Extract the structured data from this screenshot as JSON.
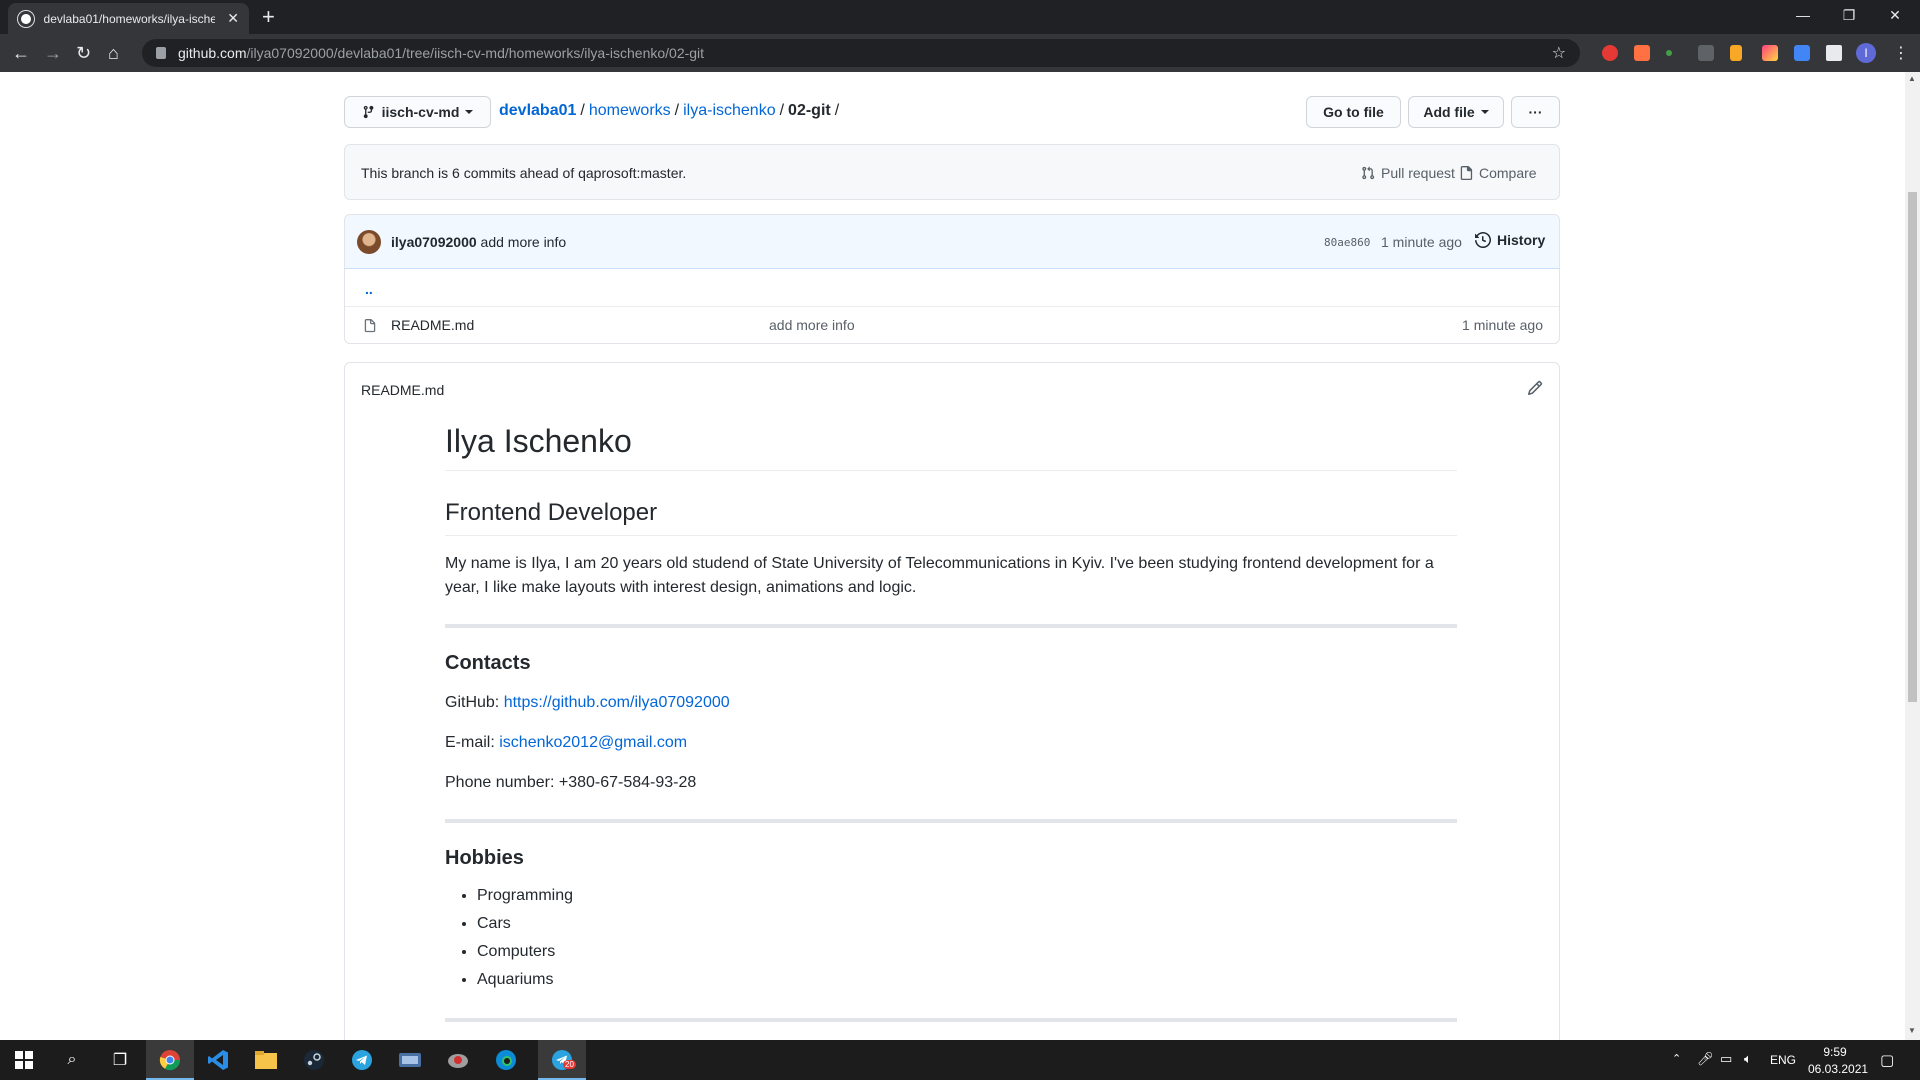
{
  "browser": {
    "tab_title": "devlaba01/homeworks/ilya-ische",
    "url_host": "github.com",
    "url_path": "/ilya07092000/devlaba01/tree/iisch-cv-md/homeworks/ilya-ischenko/02-git",
    "profile_initial": "I"
  },
  "repo": {
    "branch": "iisch-cv-md",
    "breadcrumb": {
      "root": "devlaba01",
      "parts": [
        "homeworks",
        "ilya-ischenko"
      ],
      "current": "02-git"
    },
    "go_to_file": "Go to file",
    "add_file": "Add file",
    "more": "···",
    "ahead_message": "This branch is 6 commits ahead of qaprosoft:master.",
    "pull_request": "Pull request",
    "compare": "Compare"
  },
  "commit": {
    "author": "ilya07092000",
    "message": "add more info",
    "sha": "80ae860",
    "time": "1 minute ago",
    "history": "History"
  },
  "files": {
    "parent": "..",
    "rows": [
      {
        "name": "README.md",
        "message": "add more info",
        "age": "1 minute ago"
      }
    ]
  },
  "readme": {
    "header": "README.md",
    "title": "Ilya Ischenko",
    "subtitle": "Frontend Developer",
    "intro": "My name is Ilya, I am 20 years old studend of State University of Telecommunications in Kyiv. I've been studying frontend development for a year, I like make layouts with interest design, animations and logic.",
    "contacts_heading": "Contacts",
    "github_label": "GitHub:",
    "github_link": "https://github.com/ilya07092000",
    "email_label": "E-mail:",
    "email_link": "ischenko2012@gmail.com",
    "phone": "Phone number: +380-67-584-93-28",
    "hobbies_heading": "Hobbies",
    "hobbies": [
      "Programming",
      "Cars",
      "Computers",
      "Aquariums"
    ]
  },
  "taskbar": {
    "lang": "ENG",
    "time": "9:59",
    "date": "06.03.2021",
    "telegram_badge": "20"
  }
}
